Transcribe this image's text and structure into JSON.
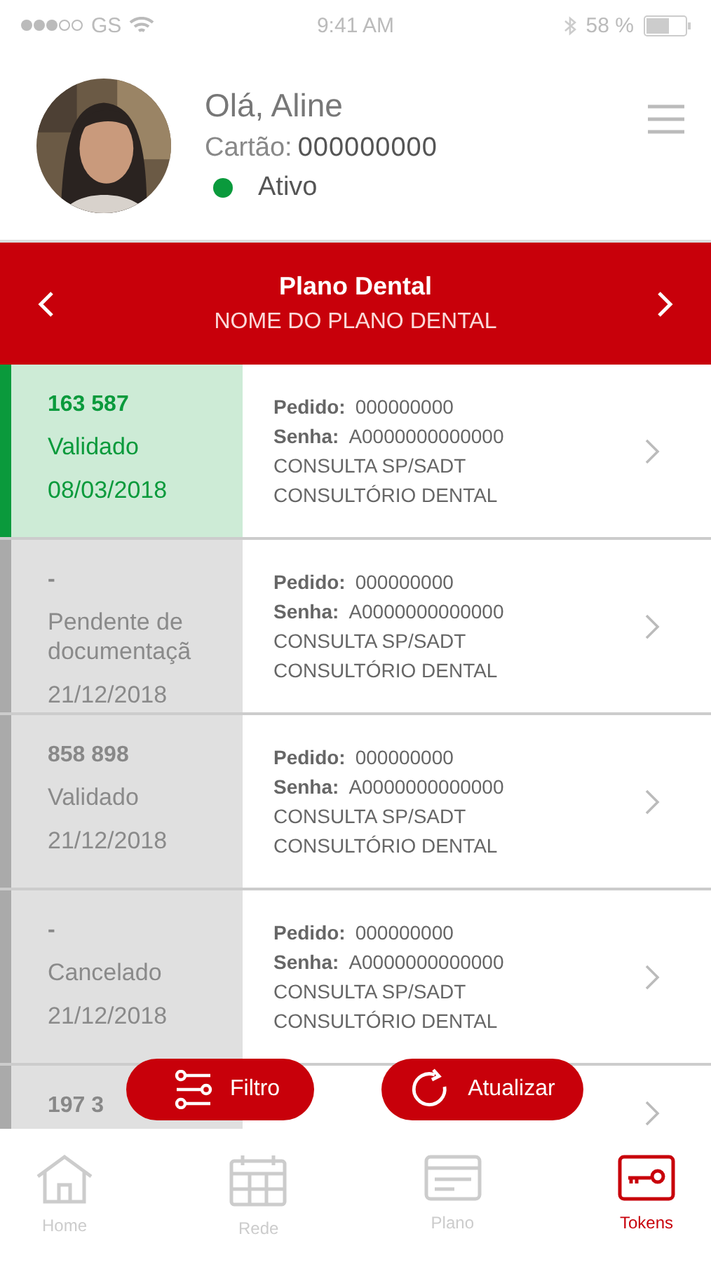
{
  "status_bar": {
    "carrier": "GS",
    "time": "9:41 AM",
    "battery": "58 %"
  },
  "profile": {
    "greeting": "Olá, Aline",
    "card_label": "Cartão:",
    "card_number": "000000000",
    "status": "Ativo"
  },
  "plan": {
    "title": "Plano Dental",
    "name": "NOME DO PLANO DENTAL"
  },
  "tokens": [
    {
      "kind": "full",
      "selected": true,
      "code": "163 587",
      "status": "Validado",
      "date": "08/03/2018",
      "pedido_label": "Pedido:",
      "pedido": "000000000",
      "senha_label": "Senha:",
      "senha": "A0000000000000",
      "line_1": "CONSULTA SP/SADT",
      "line_2": "CONSULTÓRIO DENTAL"
    },
    {
      "kind": "full",
      "selected": false,
      "code": "-",
      "status": "Pendente de documentaçã",
      "date": "21/12/2018",
      "pedido_label": "Pedido:",
      "pedido": "000000000",
      "senha_label": "Senha:",
      "senha": "A0000000000000",
      "line_1": "CONSULTA SP/SADT",
      "line_2": "CONSULTÓRIO DENTAL"
    },
    {
      "kind": "full",
      "selected": false,
      "code": "858 898",
      "status": "Validado",
      "date": "21/12/2018",
      "pedido_label": "Pedido:",
      "pedido": "000000000",
      "senha_label": "Senha:",
      "senha": "A0000000000000",
      "line_1": "CONSULTA SP/SADT",
      "line_2": "CONSULTÓRIO DENTAL"
    },
    {
      "kind": "full",
      "selected": false,
      "code": "-",
      "status": "Cancelado",
      "date": "21/12/2018",
      "pedido_label": "Pedido:",
      "pedido": "000000000",
      "senha_label": "Senha:",
      "senha": "A0000000000000",
      "line_1": "CONSULTA SP/SADT",
      "line_2": "CONSULTÓRIO DENTAL"
    },
    {
      "kind": "partial",
      "selected": false,
      "code": "197 3"
    }
  ],
  "actions": [
    {
      "kind": "filter",
      "label": "Filtro"
    },
    {
      "kind": "refresh",
      "label": "Atualizar"
    }
  ],
  "tabs": [
    {
      "kind": "home",
      "label": "Home",
      "selected": false
    },
    {
      "kind": "calendar",
      "label": "Rede",
      "selected": false
    },
    {
      "kind": "card",
      "label": "Plano",
      "selected": false
    },
    {
      "kind": "key",
      "label": "Tokens",
      "selected": true
    }
  ]
}
